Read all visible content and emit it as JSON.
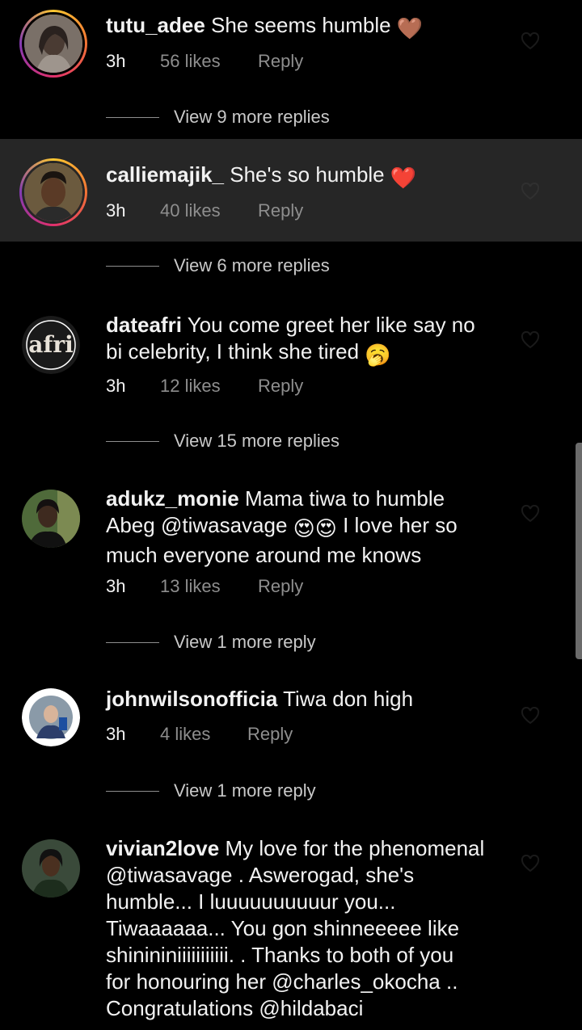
{
  "comments": [
    {
      "username": "tutu_adee",
      "text": "She seems humble",
      "emoji": "🤎",
      "time": "3h",
      "likes": "56 likes",
      "reply": "Reply",
      "view_replies": "View 9 more replies",
      "story_ring": true,
      "highlighted": false
    },
    {
      "username": "calliemajik_",
      "text": "She's so humble",
      "emoji": "❤️",
      "time": "3h",
      "likes": "40 likes",
      "reply": "Reply",
      "view_replies": "View 6 more replies",
      "story_ring": true,
      "highlighted": true
    },
    {
      "username": "dateafri",
      "text_line1": "You come greet her like say no",
      "text_line2": "bi celebrity, I think she tired",
      "emoji": "🥱",
      "time": "3h",
      "likes": "12 likes",
      "reply": "Reply",
      "view_replies": "View 15 more replies",
      "avatar_text": "afri",
      "story_ring": false,
      "highlighted": false
    },
    {
      "username": "adukz_monie",
      "text_line1": "Mama tiwa to humble",
      "text_line2a": "Abeg @tiwasavage",
      "emoji": "😍😍",
      "text_line2b": "I love her so",
      "text_line3": "much everyone around me knows",
      "time": "3h",
      "likes": "13 likes",
      "reply": "Reply",
      "view_replies": "View 1 more reply",
      "story_ring": false,
      "highlighted": false
    },
    {
      "username": "johnwilsonofficia",
      "text": "Tiwa don high",
      "time": "3h",
      "likes": "4 likes",
      "reply": "Reply",
      "view_replies": "View 1 more reply",
      "story_ring": false,
      "highlighted": false
    },
    {
      "username": "vivian2love",
      "lines": [
        "My love for the phenomenal",
        "@tiwasavage . Aswerogad, she's",
        "humble... I luuuuuuuuuur you...",
        "Tiwaaaaaa... You gon shinneeeee like",
        "shinininiiiiiiiiiii. . Thanks to both of you",
        "for honouring her @charles_okocha ..",
        "Congratulations @hildabaci"
      ],
      "story_ring": false,
      "highlighted": false
    }
  ],
  "icons": {
    "like": "heart-outline-icon"
  },
  "colors": {
    "background": "#000000",
    "highlight": "#262626",
    "meta_text": "#8e8e8e",
    "primary_text": "#f2f2f2"
  }
}
